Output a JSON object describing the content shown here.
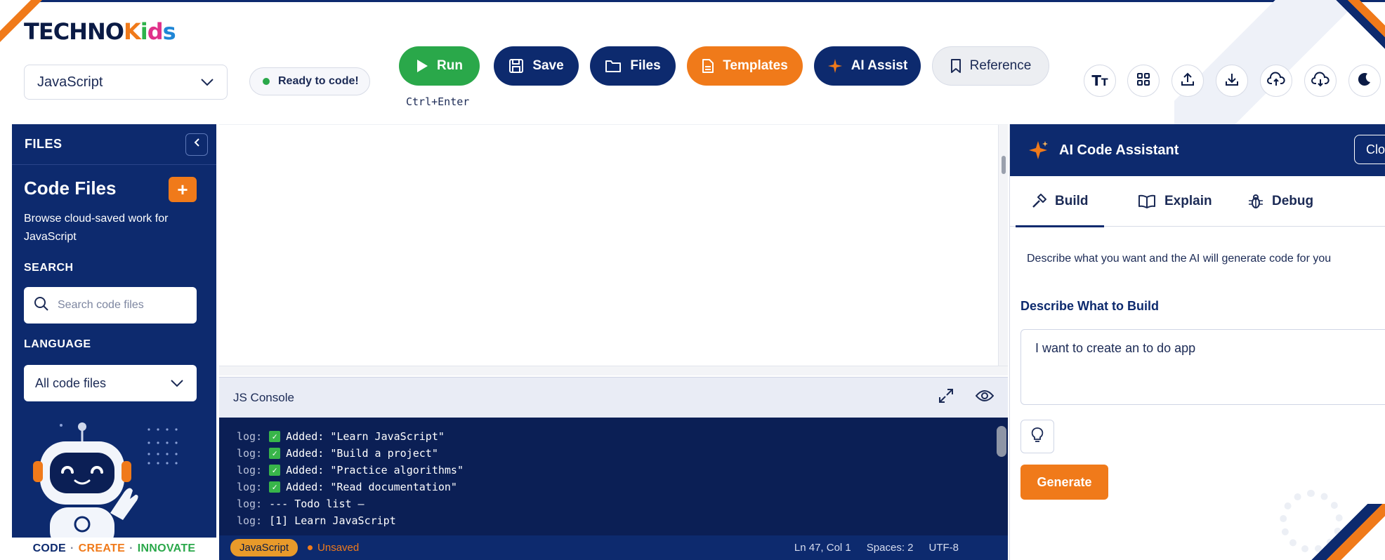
{
  "brand": {
    "logo_part1": "TECHNO",
    "logo_k": "K",
    "logo_i": "i",
    "logo_d": "d",
    "logo_s": "s"
  },
  "toolbar": {
    "language_select": "JavaScript",
    "status": "Ready to code!",
    "run_label": "Run",
    "run_shortcut": "Ctrl+Enter",
    "save_label": "Save",
    "files_label": "Files",
    "templates_label": "Templates",
    "ai_assist_label": "AI Assist",
    "reference_label": "Reference",
    "icon_buttons": [
      "font-size-icon",
      "grid-icon",
      "upload-icon",
      "download-icon",
      "cloud-upload-icon",
      "cloud-download-icon",
      "moon-icon"
    ]
  },
  "sidebar": {
    "header": "FILES",
    "title": "Code Files",
    "description": "Browse cloud-saved work for JavaScript",
    "search_label": "SEARCH",
    "search_placeholder": "Search code files",
    "language_label": "LANGUAGE",
    "language_value": "All code files",
    "tagline_code": "CODE",
    "tagline_sep": "·",
    "tagline_create": "CREATE",
    "tagline_innovate": "INNOVATE"
  },
  "console": {
    "title": "JS Console",
    "lines": [
      {
        "level": "log:",
        "check": true,
        "text": "Added: \"Learn JavaScript\""
      },
      {
        "level": "log:",
        "check": true,
        "text": "Added: \"Build a project\""
      },
      {
        "level": "log:",
        "check": true,
        "text": "Added: \"Practice algorithms\""
      },
      {
        "level": "log:",
        "check": true,
        "text": "Added: \"Read documentation\""
      },
      {
        "level": "log:",
        "check": false,
        "text": "--- Todo list —"
      },
      {
        "level": "log:",
        "check": false,
        "text": "[1] Learn JavaScript"
      }
    ]
  },
  "statusbar": {
    "language": "JavaScript",
    "unsaved": "Unsaved",
    "position": "Ln 47, Col 1",
    "spaces": "Spaces: 2",
    "encoding": "UTF-8"
  },
  "ai_panel": {
    "title": "AI Code Assistant",
    "close_label": "Clo",
    "tabs": [
      {
        "label": "Build",
        "icon": "hammer-icon",
        "active": true
      },
      {
        "label": "Explain",
        "icon": "book-icon",
        "active": false
      },
      {
        "label": "Debug",
        "icon": "bug-icon",
        "active": false
      }
    ],
    "description": "Describe what you want and the AI will generate code for you",
    "input_label": "Describe What to Build",
    "input_value": "I want to create an to do app",
    "generate_label": "Generate"
  },
  "colors": {
    "navy": "#0d2a6e",
    "orange": "#f07a1a",
    "green": "#2aa84a"
  }
}
